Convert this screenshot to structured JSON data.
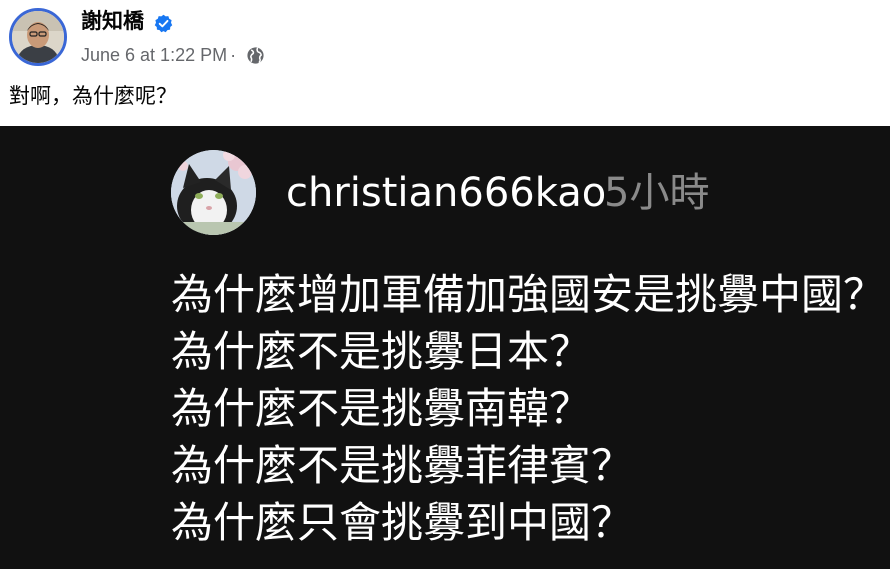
{
  "post": {
    "author": "謝知橋",
    "timestamp": "June 6 at 1:22 PM",
    "separator": "·",
    "text": "對啊，為什麼呢？",
    "verified_icon": "verified-badge-icon",
    "audience_icon": "globe-icon"
  },
  "embedded_comment": {
    "username": "christian666kao",
    "time": "5小時",
    "lines": [
      "為什麼增加軍備加強國安是挑釁中國？",
      "為什麼不是挑釁日本？",
      "為什麼不是挑釁南韓？",
      "為什麼不是挑釁菲律賓？",
      "為什麼只會挑釁到中國？"
    ]
  },
  "colors": {
    "name_text": "#050505",
    "meta_text": "#65676b",
    "verified_blue": "#1877f2",
    "media_background": "#111111",
    "comment_text": "#ffffff",
    "comment_time": "#8a8a8a"
  }
}
